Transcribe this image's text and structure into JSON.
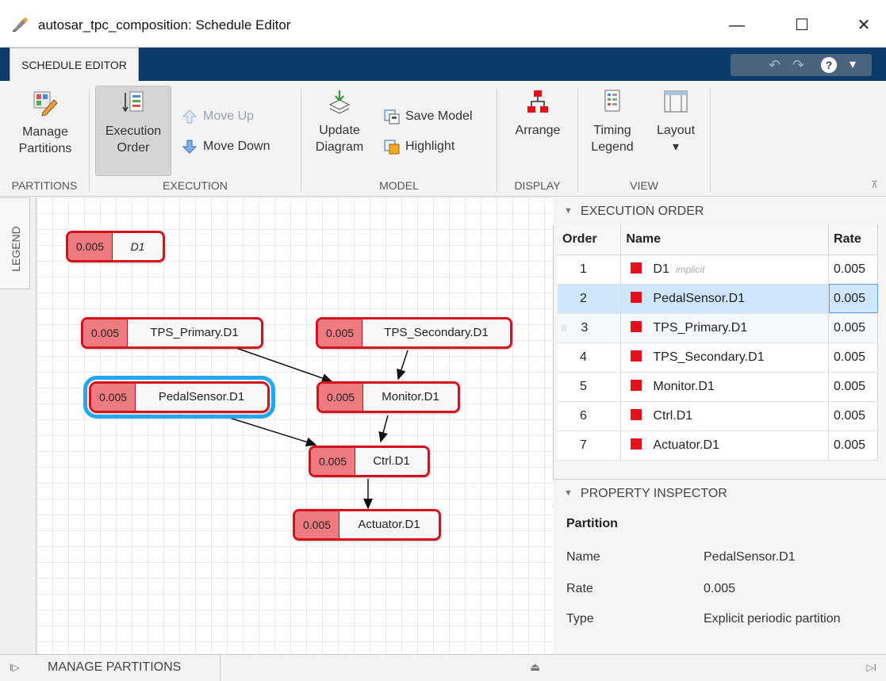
{
  "window": {
    "title": "autosar_tpc_composition: Schedule Editor",
    "minimize": "—",
    "maximize": "☐",
    "close": "✕"
  },
  "tab": {
    "label": "SCHEDULE EDITOR"
  },
  "quick_access": {
    "undo": "↶",
    "redo": "↷",
    "help": "?",
    "menu": "▾"
  },
  "ribbon": {
    "partitions": {
      "manage_line1": "Manage",
      "manage_line2": "Partitions",
      "group": "PARTITIONS"
    },
    "execution": {
      "order_line1": "Execution",
      "order_line2": "Order",
      "move_up": "Move Up",
      "move_down": "Move Down",
      "group": "EXECUTION"
    },
    "model": {
      "update_line1": "Update",
      "update_line2": "Diagram",
      "save_model": "Save Model",
      "highlight": "Highlight",
      "group": "MODEL"
    },
    "display": {
      "arrange": "Arrange",
      "group": "DISPLAY"
    },
    "view": {
      "timing_line1": "Timing",
      "timing_line2": "Legend",
      "layout": "Layout",
      "layout_arrow": "▾",
      "group": "VIEW"
    },
    "collapse": "⊼"
  },
  "legend_label": "LEGEND",
  "blocks": [
    {
      "rate": "0.005",
      "name": "D1"
    },
    {
      "rate": "0.005",
      "name": "TPS_Primary.D1"
    },
    {
      "rate": "0.005",
      "name": "TPS_Secondary.D1"
    },
    {
      "rate": "0.005",
      "name": "PedalSensor.D1"
    },
    {
      "rate": "0.005",
      "name": "Monitor.D1"
    },
    {
      "rate": "0.005",
      "name": "Ctrl.D1"
    },
    {
      "rate": "0.005",
      "name": "Actuator.D1"
    }
  ],
  "execution_order": {
    "header": "EXECUTION ORDER",
    "columns": [
      "Order",
      "Name",
      "Rate"
    ],
    "rows": [
      {
        "order": "1",
        "name": "D1",
        "tag": "implicit",
        "rate": "0.005"
      },
      {
        "order": "2",
        "name": "PedalSensor.D1",
        "rate": "0.005"
      },
      {
        "order": "3",
        "name": "TPS_Primary.D1",
        "rate": "0.005"
      },
      {
        "order": "4",
        "name": "TPS_Secondary.D1",
        "rate": "0.005"
      },
      {
        "order": "5",
        "name": "Monitor.D1",
        "rate": "0.005"
      },
      {
        "order": "6",
        "name": "Ctrl.D1",
        "rate": "0.005"
      },
      {
        "order": "7",
        "name": "Actuator.D1",
        "rate": "0.005"
      }
    ],
    "selected_row": 2
  },
  "property_inspector": {
    "header": "PROPERTY INSPECTOR",
    "title": "Partition",
    "name_label": "Name",
    "name_value": "PedalSensor.D1",
    "rate_label": "Rate",
    "rate_value": "0.005",
    "type_label": "Type",
    "type_value": "Explicit periodic partition"
  },
  "bottom": {
    "manage_partitions": "MANAGE PARTITIONS",
    "left_icon": "I▷",
    "eject": "⏏",
    "right_icon": "▷I"
  },
  "colors": {
    "accent_blue": "#0b3c6b",
    "partition_red": "#e3111b",
    "selection_blue": "#23a8ee",
    "row_selected": "#cfe6fb"
  }
}
